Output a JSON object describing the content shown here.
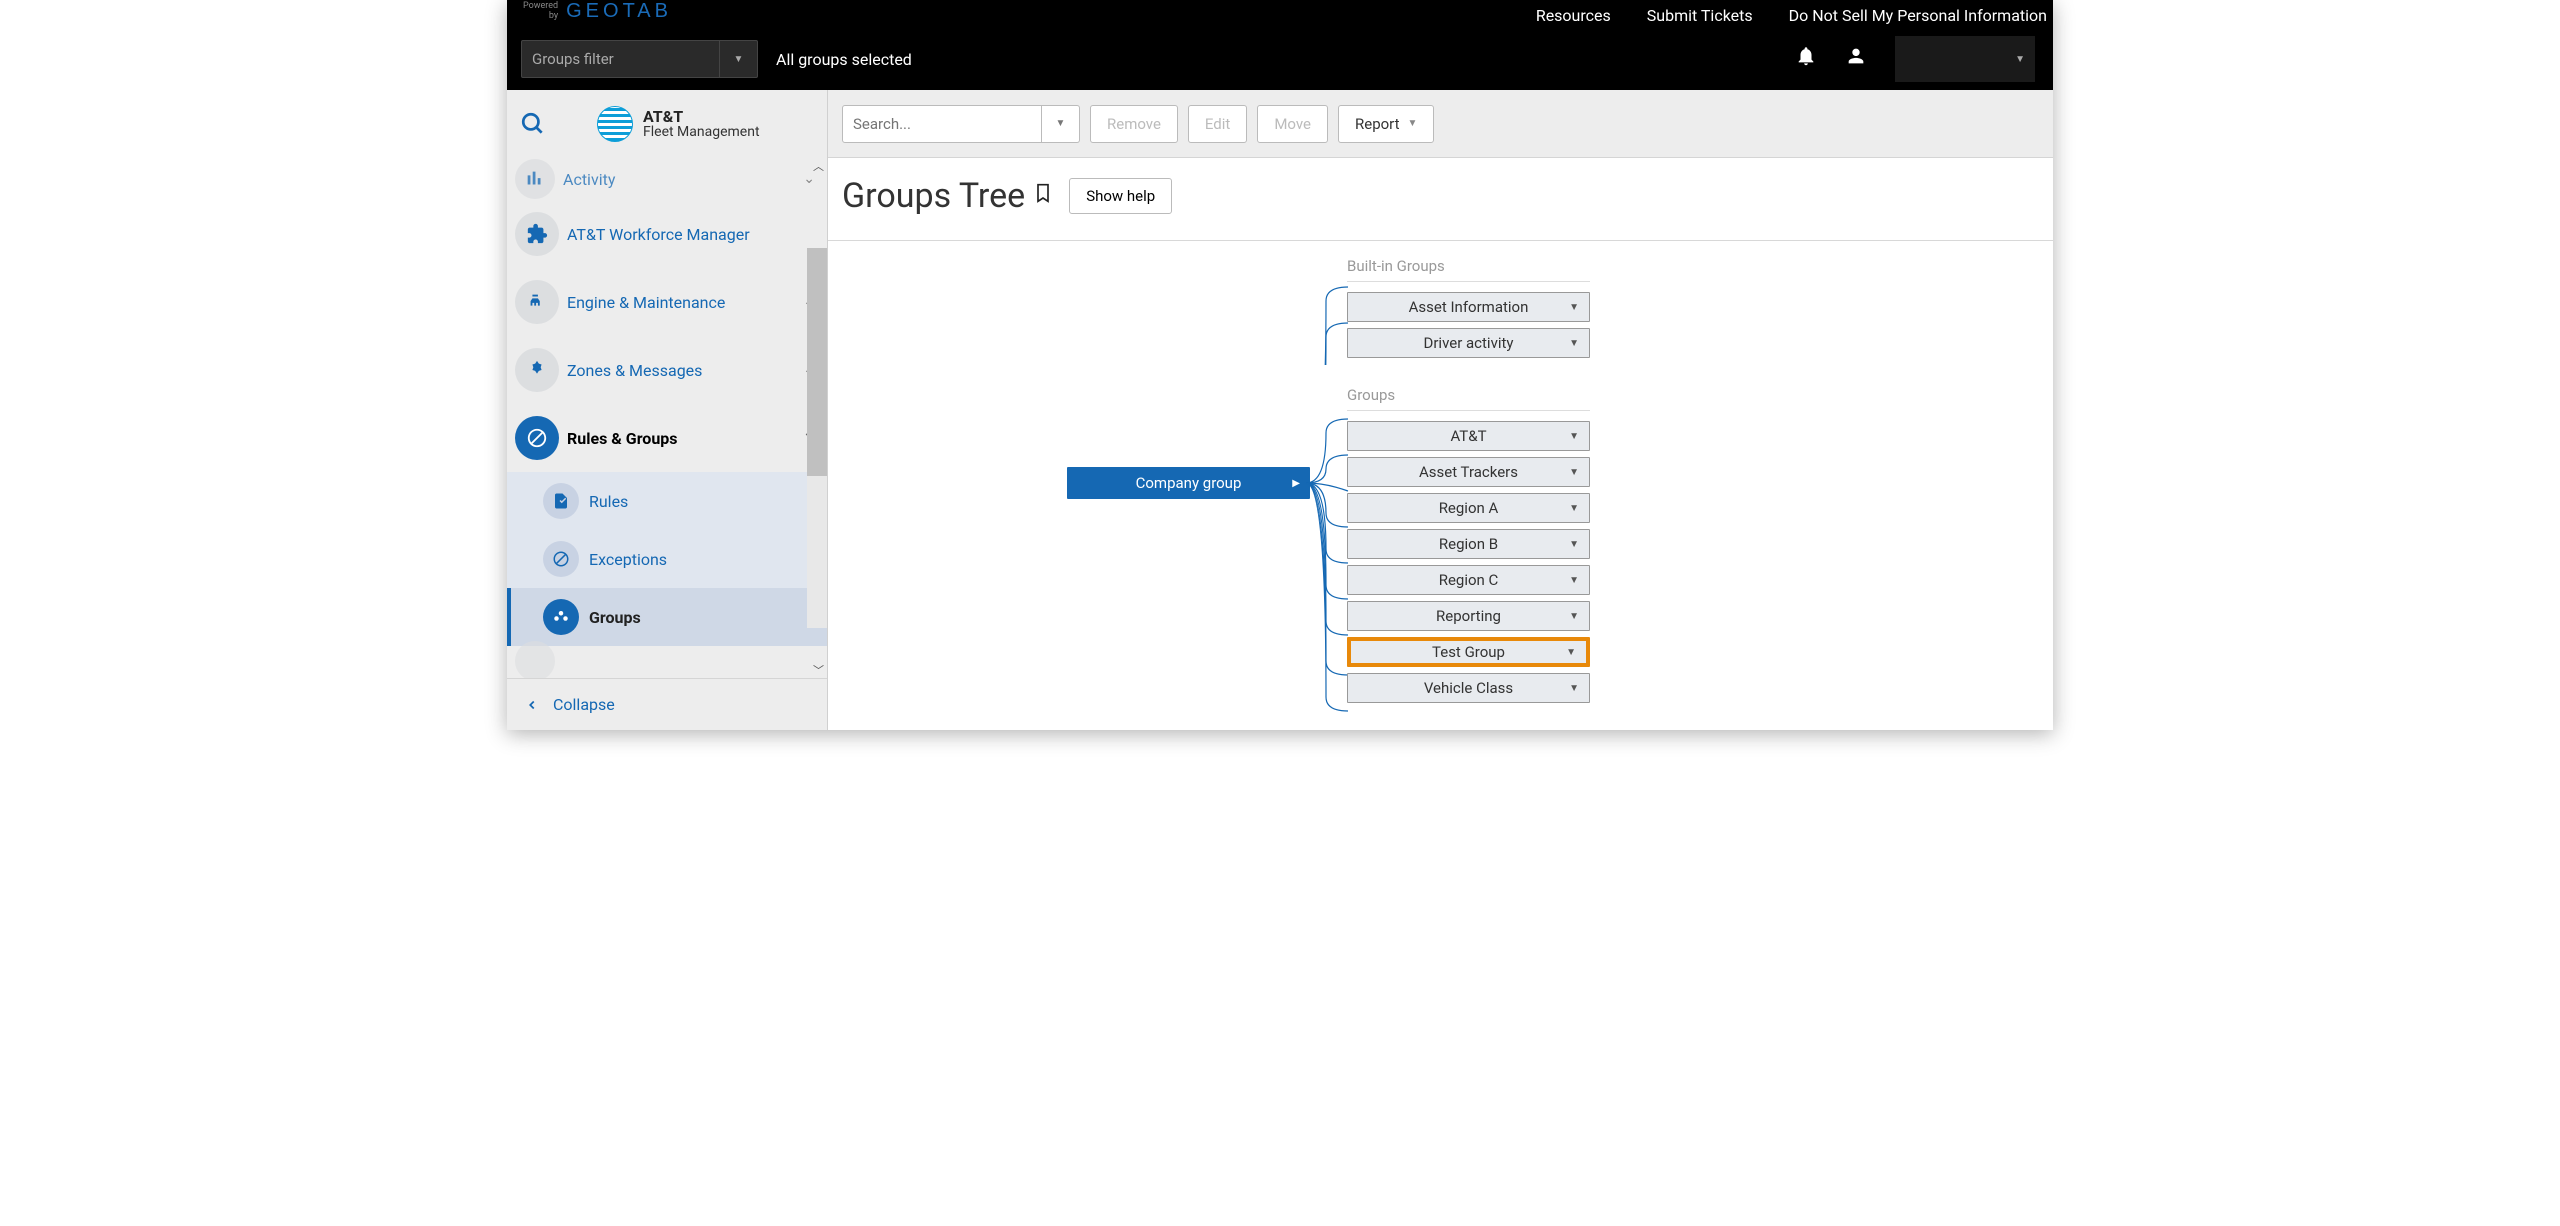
{
  "header": {
    "powered_label": "Powered\nby",
    "geotab": "GEOTAB",
    "links": [
      "Resources",
      "Submit Tickets",
      "Do Not Sell My Personal Information"
    ],
    "groups_filter_placeholder": "Groups filter",
    "all_groups": "All groups selected"
  },
  "brand": {
    "title": "AT&T",
    "subtitle": "Fleet Management"
  },
  "sidebar": {
    "items": [
      {
        "label": "Activity",
        "expandable": true
      },
      {
        "label": "AT&T Workforce Manager",
        "expandable": false
      },
      {
        "label": "Engine & Maintenance",
        "expandable": true
      },
      {
        "label": "Zones & Messages",
        "expandable": true
      },
      {
        "label": "Rules & Groups",
        "expandable": true,
        "active": true
      }
    ],
    "sub_items": [
      {
        "label": "Rules"
      },
      {
        "label": "Exceptions"
      },
      {
        "label": "Groups",
        "selected": true
      }
    ],
    "collapse": "Collapse"
  },
  "toolbar": {
    "search_placeholder": "Search...",
    "remove": "Remove",
    "edit": "Edit",
    "move": "Move",
    "report": "Report"
  },
  "page": {
    "title": "Groups Tree",
    "show_help": "Show help"
  },
  "tree": {
    "builtin_label": "Built-in Groups",
    "groups_label": "Groups",
    "root": "Company group",
    "builtin": [
      "Asset Information",
      "Driver activity"
    ],
    "groups": [
      "AT&T",
      "Asset Trackers",
      "Region A",
      "Region B",
      "Region C",
      "Reporting",
      "Test Group",
      "Vehicle Class"
    ],
    "highlighted": "Test Group"
  }
}
